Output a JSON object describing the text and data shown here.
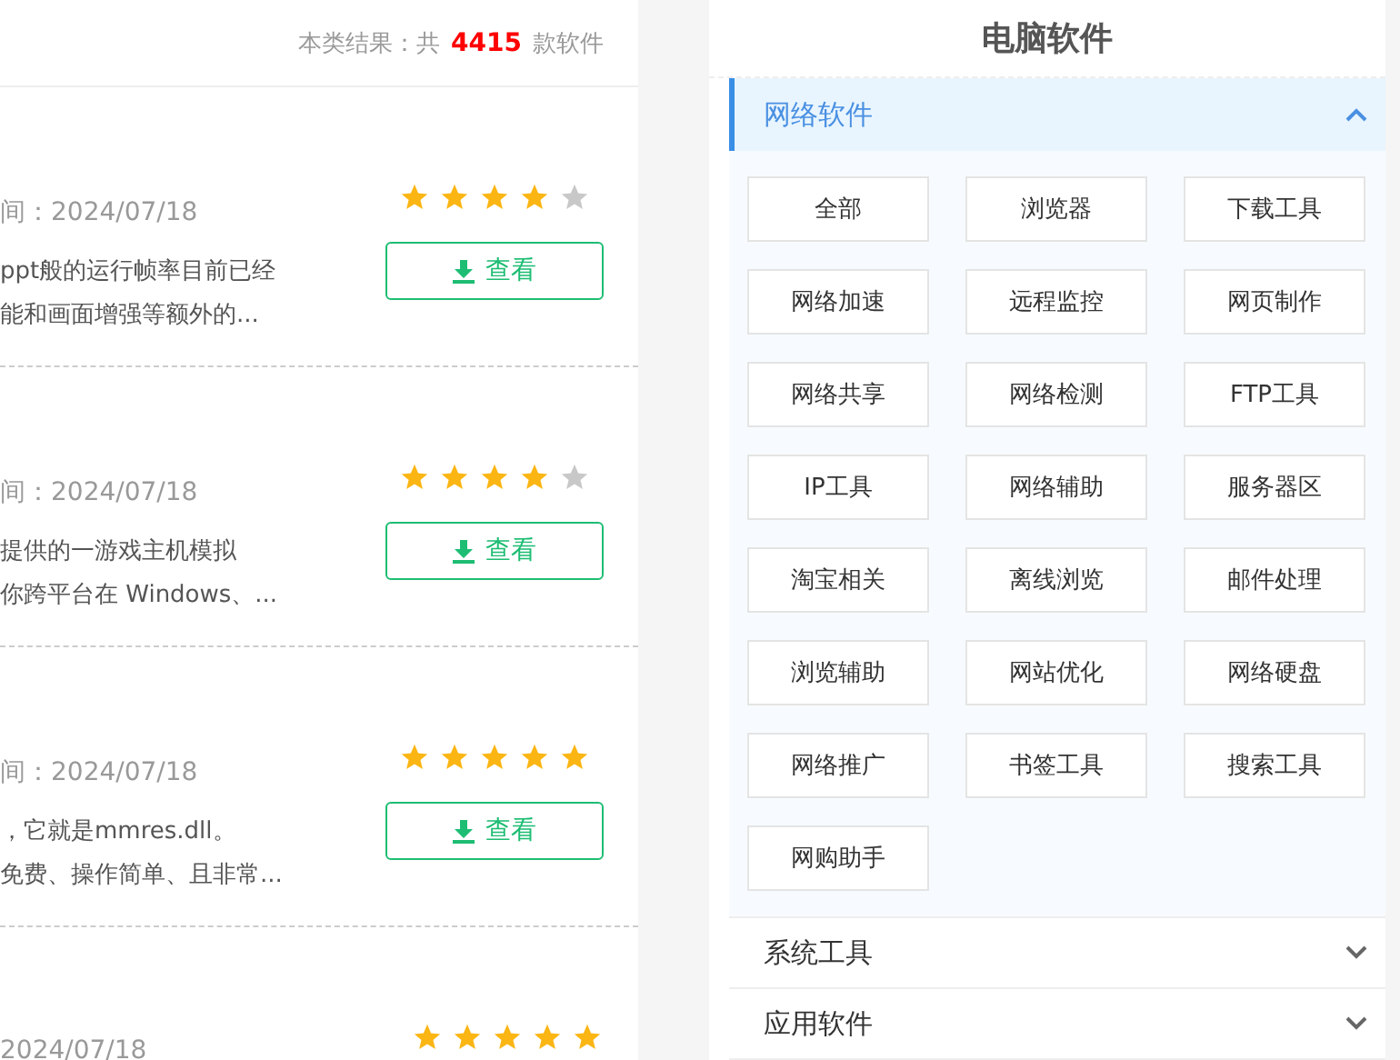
{
  "results": {
    "prefix": "本类结果：共",
    "count": "4415",
    "suffix": "款软件"
  },
  "items": [
    {
      "date": "间：2024/07/18",
      "stars": 4,
      "lines": [
        "ppt般的运行帧率目前已经",
        "能和画面增强等额外的..."
      ],
      "button": "查看"
    },
    {
      "date": "间：2024/07/18",
      "stars": 4,
      "lines": [
        "提供的一游戏主机模拟",
        "你跨平台在 Windows、..."
      ],
      "button": "查看"
    },
    {
      "date": "间：2024/07/18",
      "stars": 5,
      "lines": [
        "，它就是mmres.dll。",
        "免费、操作简单、且非常..."
      ],
      "button": "查看"
    },
    {
      "date": "2024/07/18",
      "stars": 5
    }
  ],
  "sidebar": {
    "title": "电脑软件",
    "sections": [
      {
        "label": "网络软件",
        "expanded": true,
        "categories": [
          "全部",
          "浏览器",
          "下载工具",
          "网络加速",
          "远程监控",
          "网页制作",
          "网络共享",
          "网络检测",
          "FTP工具",
          "IP工具",
          "网络辅助",
          "服务器区",
          "淘宝相关",
          "离线浏览",
          "邮件处理",
          "浏览辅助",
          "网站优化",
          "网络硬盘",
          "网络推广",
          "书签工具",
          "搜索工具",
          "网购助手"
        ]
      },
      {
        "label": "系统工具",
        "expanded": false
      },
      {
        "label": "应用软件",
        "expanded": false
      }
    ]
  }
}
